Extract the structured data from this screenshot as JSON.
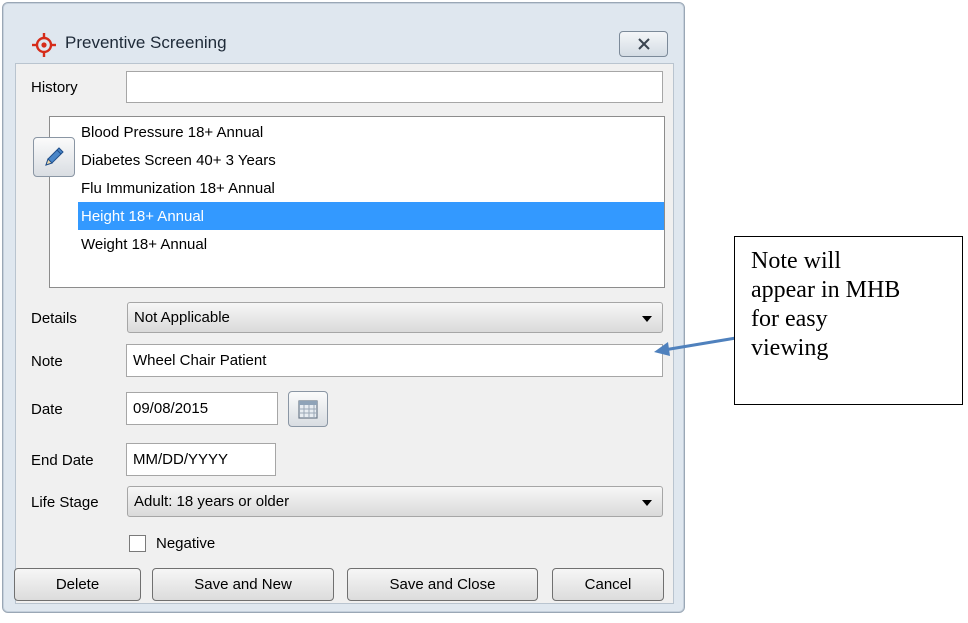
{
  "window": {
    "title": "Preventive Screening",
    "close_icon": "close-x-icon",
    "app_icon": "target-crosshair-icon"
  },
  "form": {
    "history_label": "History",
    "history_value": "",
    "screening_list": [
      {
        "label": "Blood Pressure 18+ Annual",
        "selected": false
      },
      {
        "label": "Diabetes Screen 40+ 3 Years",
        "selected": false
      },
      {
        "label": "Flu Immunization 18+ Annual",
        "selected": false
      },
      {
        "label": "Height 18+ Annual",
        "selected": true
      },
      {
        "label": "Weight 18+ Annual",
        "selected": false
      }
    ],
    "edit_icon": "pencil-icon",
    "details_label": "Details",
    "details_value": "Not Applicable",
    "note_label": "Note",
    "note_value": "Wheel Chair Patient",
    "date_label": "Date",
    "date_value": "09/08/2015",
    "calendar_icon": "calendar-icon",
    "end_date_label": "End Date",
    "end_date_placeholder": "MM/DD/YYYY",
    "life_stage_label": "Life Stage",
    "life_stage_value": "Adult: 18 years or older",
    "negative_label": "Negative",
    "negative_checked": false
  },
  "buttons": {
    "delete": "Delete",
    "save_new": "Save and New",
    "save_close": "Save and Close",
    "cancel": "Cancel"
  },
  "callout": {
    "text_lines": [
      "Note will",
      "appear in MHB",
      "for easy",
      "viewing"
    ]
  },
  "colors": {
    "selection": "#3399ff",
    "window_frame": "#dfe7ef",
    "app_icon_color": "#d62c1a",
    "arrow_color": "#4f81bd"
  }
}
